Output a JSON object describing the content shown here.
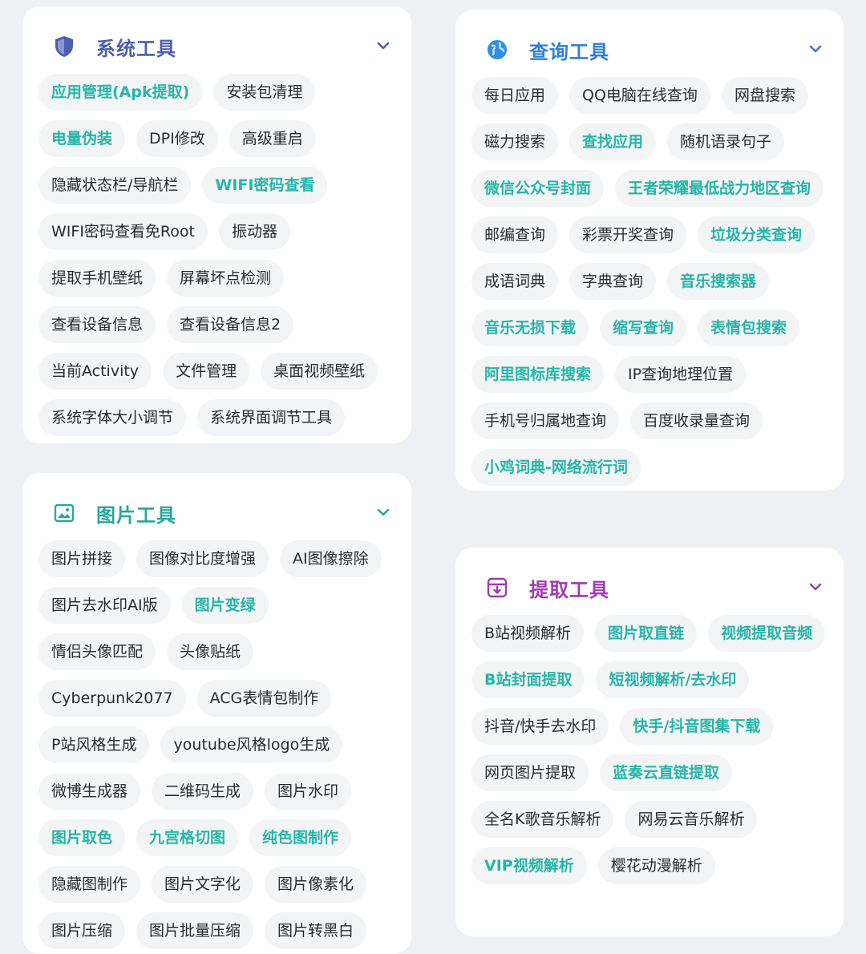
{
  "colors": {
    "highlight": "#27b5a8",
    "system_accent": "#4d5fb0",
    "query_accent": "#2f7fd6",
    "image_accent": "#27a89c",
    "extract_accent": "#a03bb0"
  },
  "sections": {
    "system": {
      "title": "系统工具",
      "icon": "shield-icon",
      "items": [
        {
          "label": "应用管理(Apk提取)",
          "highlight": true
        },
        {
          "label": "安装包清理",
          "highlight": false
        },
        {
          "label": "电量伪装",
          "highlight": true
        },
        {
          "label": "DPI修改",
          "highlight": false
        },
        {
          "label": "高级重启",
          "highlight": false
        },
        {
          "label": "隐藏状态栏/导航栏",
          "highlight": false
        },
        {
          "label": "WIFI密码查看",
          "highlight": true
        },
        {
          "label": "WIFI密码查看免Root",
          "highlight": false
        },
        {
          "label": "振动器",
          "highlight": false
        },
        {
          "label": "提取手机壁纸",
          "highlight": false
        },
        {
          "label": "屏幕坏点检测",
          "highlight": false
        },
        {
          "label": "查看设备信息",
          "highlight": false
        },
        {
          "label": "查看设备信息2",
          "highlight": false
        },
        {
          "label": "当前Activity",
          "highlight": false
        },
        {
          "label": "文件管理",
          "highlight": false
        },
        {
          "label": "桌面视频壁纸",
          "highlight": false
        },
        {
          "label": "系统字体大小调节",
          "highlight": false
        },
        {
          "label": "系统界面调节工具",
          "highlight": false
        }
      ]
    },
    "query": {
      "title": "查询工具",
      "icon": "globe-icon",
      "items": [
        {
          "label": "每日应用",
          "highlight": false
        },
        {
          "label": "QQ电脑在线查询",
          "highlight": false
        },
        {
          "label": "网盘搜索",
          "highlight": false
        },
        {
          "label": "磁力搜索",
          "highlight": false
        },
        {
          "label": "查找应用",
          "highlight": true
        },
        {
          "label": "随机语录句子",
          "highlight": false
        },
        {
          "label": "微信公众号封面",
          "highlight": true
        },
        {
          "label": "王者荣耀最低战力地区查询",
          "highlight": true
        },
        {
          "label": "邮编查询",
          "highlight": false
        },
        {
          "label": "彩票开奖查询",
          "highlight": false
        },
        {
          "label": "垃圾分类查询",
          "highlight": true
        },
        {
          "label": "成语词典",
          "highlight": false
        },
        {
          "label": "字典查询",
          "highlight": false
        },
        {
          "label": "音乐搜索器",
          "highlight": true
        },
        {
          "label": "音乐无损下载",
          "highlight": true
        },
        {
          "label": "缩写查询",
          "highlight": true
        },
        {
          "label": "表情包搜索",
          "highlight": true
        },
        {
          "label": "阿里图标库搜索",
          "highlight": true
        },
        {
          "label": "IP查询地理位置",
          "highlight": false
        },
        {
          "label": "手机号归属地查询",
          "highlight": false
        },
        {
          "label": "百度收录量查询",
          "highlight": false
        },
        {
          "label": "小鸡词典-网络流行词",
          "highlight": true
        }
      ]
    },
    "image": {
      "title": "图片工具",
      "icon": "image-icon",
      "items": [
        {
          "label": "图片拼接",
          "highlight": false
        },
        {
          "label": "图像对比度增强",
          "highlight": false
        },
        {
          "label": "AI图像擦除",
          "highlight": false
        },
        {
          "label": "图片去水印AI版",
          "highlight": false
        },
        {
          "label": "图片变绿",
          "highlight": true
        },
        {
          "label": "情侣头像匹配",
          "highlight": false
        },
        {
          "label": "头像贴纸",
          "highlight": false
        },
        {
          "label": "Cyberpunk2077",
          "highlight": false
        },
        {
          "label": "ACG表情包制作",
          "highlight": false
        },
        {
          "label": "P站风格生成",
          "highlight": false
        },
        {
          "label": "youtube风格logo生成",
          "highlight": false
        },
        {
          "label": "微博生成器",
          "highlight": false
        },
        {
          "label": "二维码生成",
          "highlight": false
        },
        {
          "label": "图片水印",
          "highlight": false
        },
        {
          "label": "图片取色",
          "highlight": true
        },
        {
          "label": "九宫格切图",
          "highlight": true
        },
        {
          "label": "纯色图制作",
          "highlight": true
        },
        {
          "label": "隐藏图制作",
          "highlight": false
        },
        {
          "label": "图片文字化",
          "highlight": false
        },
        {
          "label": "图片像素化",
          "highlight": false
        },
        {
          "label": "图片压缩",
          "highlight": false
        },
        {
          "label": "图片批量压缩",
          "highlight": false
        },
        {
          "label": "图片转黑白",
          "highlight": false
        }
      ]
    },
    "extract": {
      "title": "提取工具",
      "icon": "download-box-icon",
      "items": [
        {
          "label": "B站视频解析",
          "highlight": false
        },
        {
          "label": "图片取直链",
          "highlight": true
        },
        {
          "label": "视频提取音频",
          "highlight": true
        },
        {
          "label": "B站封面提取",
          "highlight": true
        },
        {
          "label": "短视频解析/去水印",
          "highlight": true
        },
        {
          "label": "抖音/快手去水印",
          "highlight": false
        },
        {
          "label": "快手/抖音图集下载",
          "highlight": true
        },
        {
          "label": "网页图片提取",
          "highlight": false
        },
        {
          "label": "蓝奏云直链提取",
          "highlight": true
        },
        {
          "label": "全名K歌音乐解析",
          "highlight": false
        },
        {
          "label": "网易云音乐解析",
          "highlight": false
        },
        {
          "label": "VIP视频解析",
          "highlight": true
        },
        {
          "label": "樱花动漫解析",
          "highlight": false
        }
      ]
    }
  }
}
